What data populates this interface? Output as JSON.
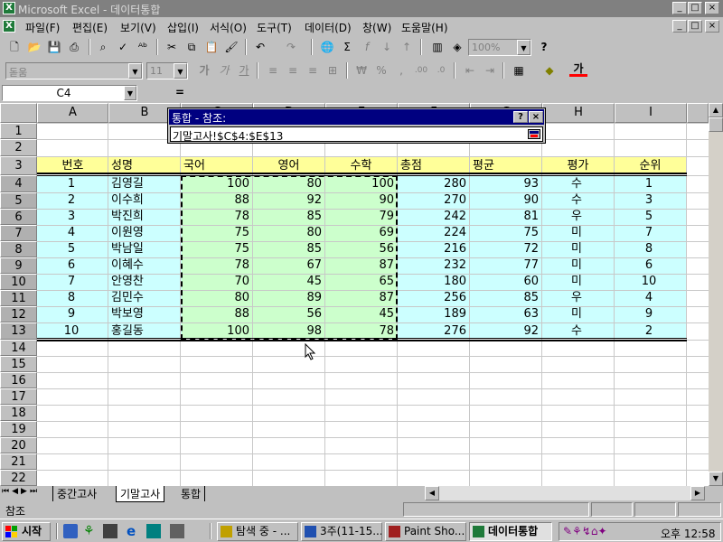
{
  "app": {
    "title": "Microsoft Excel - 데이터통합",
    "icon": "excel-icon"
  },
  "window_controls": [
    "_",
    "□",
    "×"
  ],
  "menu": [
    "파일(F)",
    "편집(E)",
    "보기(V)",
    "삽입(I)",
    "서식(O)",
    "도구(T)",
    "데이터(D)",
    "창(W)",
    "도움말(H)"
  ],
  "toolbar": {
    "zoom": "100%",
    "font_name": "돋움",
    "font_size": "11",
    "buttons_standard": [
      "new-icon",
      "open-icon",
      "save-icon",
      "print-icon",
      "preview-icon",
      "spell-icon",
      "cut-icon",
      "copy-icon",
      "paste-icon",
      "format-painter-icon",
      "undo-icon",
      "redo-icon",
      "hyperlink-icon",
      "autosum-icon",
      "function-icon",
      "sort-asc-icon",
      "sort-desc-icon",
      "chart-icon",
      "map-icon",
      "help-icon"
    ],
    "buttons_format": [
      "bold-icon",
      "italic-icon",
      "underline-icon",
      "align-left-icon",
      "center-icon",
      "align-right-icon",
      "merge-icon",
      "currency-icon",
      "percent-icon",
      "comma-icon",
      "inc-decimal-icon",
      "dec-decimal-icon",
      "dec-indent-icon",
      "inc-indent-icon",
      "borders-icon",
      "fill-color-icon",
      "font-color-icon"
    ]
  },
  "formula_bar": {
    "name_box": "C4",
    "equals": "="
  },
  "dialog": {
    "title": "통합 - 참조:",
    "help_label": "?",
    "close_label": "×",
    "reference": "기말고사!$C$4:$E$13"
  },
  "sheet": {
    "columns": [
      "A",
      "B",
      "C",
      "D",
      "E",
      "F",
      "G",
      "H",
      "I"
    ],
    "rows": [
      "1",
      "2",
      "3",
      "4",
      "5",
      "6",
      "7",
      "8",
      "9",
      "10",
      "11",
      "12",
      "13",
      "14",
      "15",
      "16",
      "17",
      "18",
      "19",
      "20",
      "21",
      "22"
    ],
    "headers": [
      "번호",
      "성명",
      "국어",
      "영어",
      "수학",
      "총점",
      "평균",
      "평가",
      "순위"
    ],
    "data": [
      [
        "1",
        "김영길",
        "100",
        "80",
        "100",
        "280",
        "93",
        "수",
        "1"
      ],
      [
        "2",
        "이수희",
        "88",
        "92",
        "90",
        "270",
        "90",
        "수",
        "3"
      ],
      [
        "3",
        "박진희",
        "78",
        "85",
        "79",
        "242",
        "81",
        "우",
        "5"
      ],
      [
        "4",
        "이원영",
        "75",
        "80",
        "69",
        "224",
        "75",
        "미",
        "7"
      ],
      [
        "5",
        "박남일",
        "75",
        "85",
        "56",
        "216",
        "72",
        "미",
        "8"
      ],
      [
        "6",
        "이혜수",
        "78",
        "67",
        "87",
        "232",
        "77",
        "미",
        "6"
      ],
      [
        "7",
        "안영찬",
        "70",
        "45",
        "65",
        "180",
        "60",
        "미",
        "10"
      ],
      [
        "8",
        "김민수",
        "80",
        "89",
        "87",
        "256",
        "85",
        "우",
        "4"
      ],
      [
        "9",
        "박보영",
        "88",
        "56",
        "45",
        "189",
        "63",
        "미",
        "9"
      ],
      [
        "10",
        "홍길동",
        "100",
        "98",
        "78",
        "276",
        "92",
        "수",
        "2"
      ]
    ],
    "colors": {
      "header_fill": "#ffff99",
      "data_fill": "#ccffff",
      "selection_fill": "#ccffcc"
    }
  },
  "sheet_tabs": [
    "중간고사",
    "기말고사",
    "통합"
  ],
  "active_tab": "기말고사",
  "status": "참조",
  "taskbar": {
    "start": "시작",
    "tasks": [
      "탐색 중 - ...",
      "3주(11-15...",
      "Paint Sho...",
      "데이터통합"
    ],
    "active_task": "데이터통합",
    "clock": "오후 12:58"
  }
}
